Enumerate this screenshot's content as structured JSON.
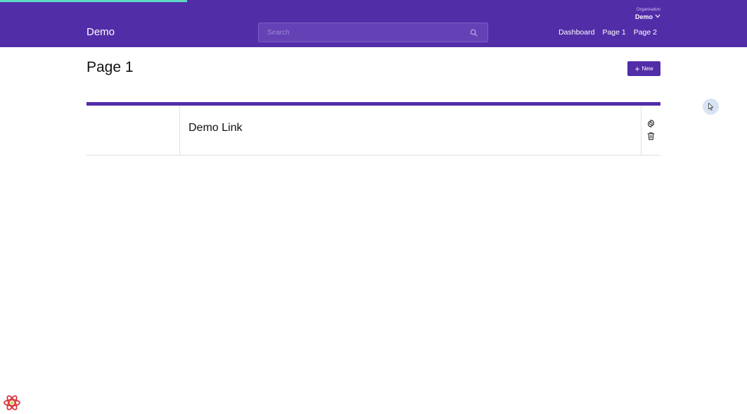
{
  "loading": {
    "progress_percent": 25
  },
  "header": {
    "brand": "Demo",
    "search": {
      "placeholder": "Search",
      "value": ""
    },
    "organisation": {
      "label": "Organisation",
      "value": "Demo"
    },
    "nav": [
      {
        "label": "Dashboard"
      },
      {
        "label": "Page 1"
      },
      {
        "label": "Page 2"
      }
    ]
  },
  "main": {
    "title": "Page 1",
    "new_button": {
      "label": "New",
      "icon": "plus-icon"
    },
    "items": [
      {
        "title": "Demo Link",
        "actions": [
          {
            "icon": "gear-icon"
          },
          {
            "icon": "trash-icon"
          }
        ]
      }
    ]
  },
  "colors": {
    "primary": "#512da8",
    "progress": "#5fd8c6",
    "search_bg": "#6442b6",
    "divider": "#e2e2e2"
  },
  "icons": {
    "search": "search-icon",
    "chevron": "chevron-down-icon",
    "cursor": "mouse-cursor-icon",
    "devtools": "react-logo-icon"
  }
}
